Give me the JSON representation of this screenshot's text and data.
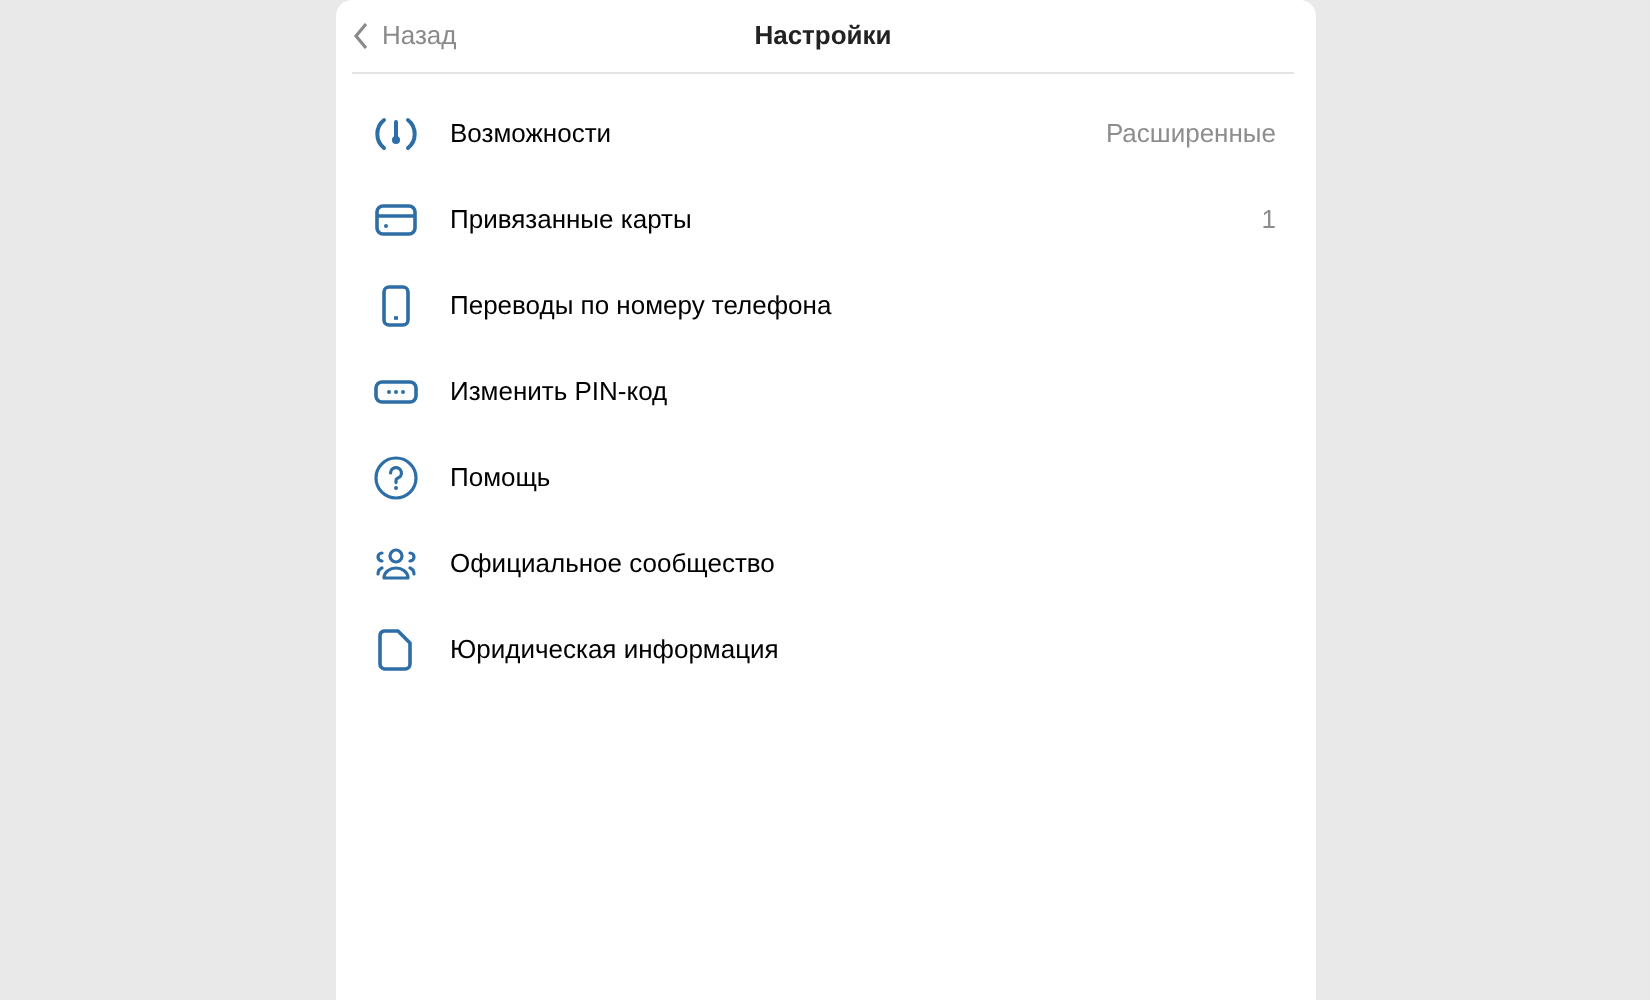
{
  "header": {
    "back": "Назад",
    "title": "Настройки"
  },
  "items": [
    {
      "kind": "gauge",
      "label": "Возможности",
      "value": "Расширенные"
    },
    {
      "kind": "card",
      "label": "Привязанные карты",
      "value": "1"
    },
    {
      "kind": "phone",
      "label": "Переводы по номеру телефона"
    },
    {
      "kind": "pin",
      "label": "Изменить PIN-код"
    },
    {
      "kind": "help",
      "label": "Помощь"
    },
    {
      "kind": "people",
      "label": "Официальное сообщество"
    },
    {
      "kind": "document",
      "label": "Юридическая информация"
    }
  ]
}
